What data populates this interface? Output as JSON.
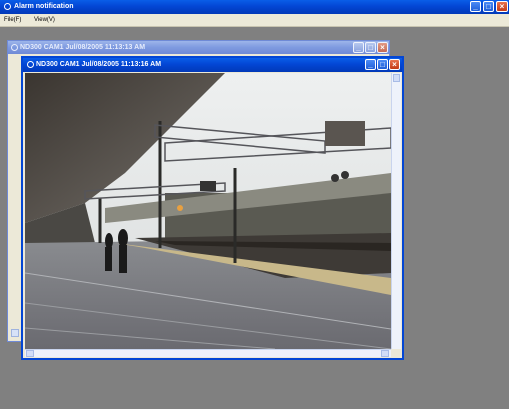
{
  "app": {
    "title": "Alarm notification",
    "menu": [
      "File(F)",
      "View(V)"
    ]
  },
  "windows": [
    {
      "title": "ND300 CAM1 Jul/08/2005 11:13:13 AM",
      "active": false
    },
    {
      "title": "ND300 CAM1 Jul/08/2005 11:13:16 AM",
      "active": true
    }
  ],
  "colors": {
    "workspace": "#808080",
    "active_titlebar": "#0346d4",
    "inactive_titlebar": "#7e9ae0"
  },
  "icons": {
    "minimize": "minimize-icon",
    "maximize": "maximize-icon",
    "close": "close-icon"
  }
}
